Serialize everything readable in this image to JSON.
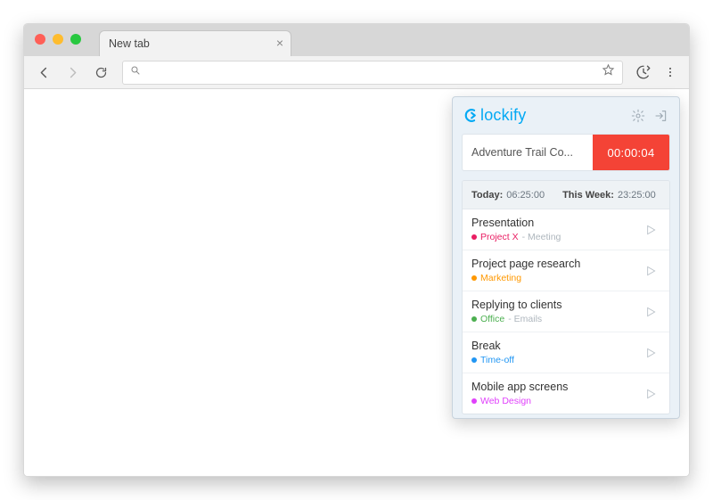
{
  "browser": {
    "tab_title": "New tab",
    "omnibox_value": ""
  },
  "popup": {
    "brand": "lockify",
    "timer": {
      "description": "Adventure Trail Co...",
      "elapsed": "00:00:04"
    },
    "summary": {
      "today_label": "Today:",
      "today_value": "06:25:00",
      "week_label": "This Week:",
      "week_value": "23:25:00"
    },
    "entries": [
      {
        "title": "Presentation",
        "project": "Project X",
        "tag": "Meeting",
        "color": "#e91e63"
      },
      {
        "title": "Project page research",
        "project": "Marketing",
        "tag": "",
        "color": "#ff9800"
      },
      {
        "title": "Replying to clients",
        "project": "Office",
        "tag": "Emails",
        "color": "#4caf50"
      },
      {
        "title": "Break",
        "project": "Time-off",
        "tag": "",
        "color": "#2196f3"
      },
      {
        "title": "Mobile app screens",
        "project": "Web Design",
        "tag": "",
        "color": "#e040fb"
      }
    ]
  }
}
